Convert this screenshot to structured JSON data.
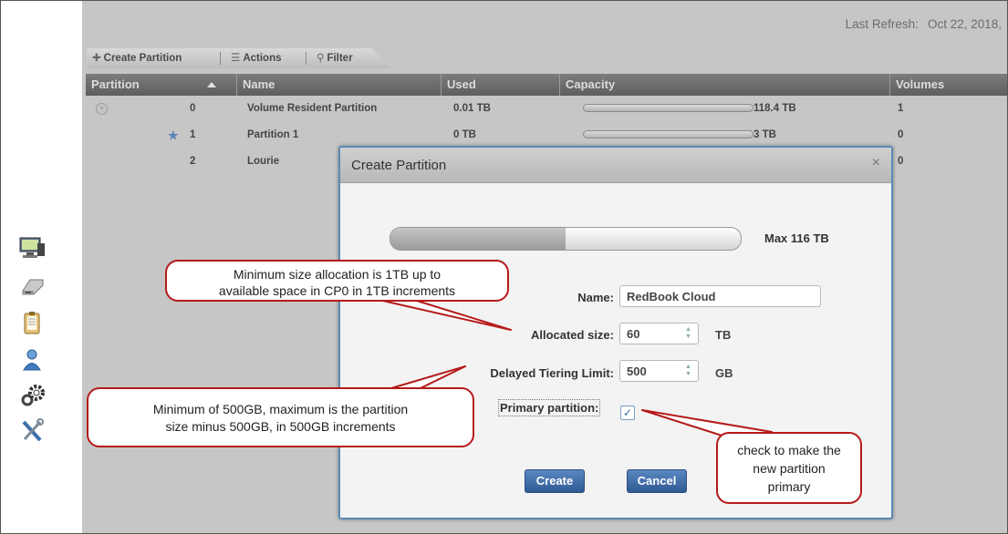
{
  "header": {
    "refresh_label": "Last Refresh:",
    "refresh_value": "Oct 22, 2018,"
  },
  "toolbar": {
    "create_label": "Create Partition",
    "actions_label": "Actions",
    "filter_label": "Filter"
  },
  "table": {
    "columns": [
      "Partition",
      "Name",
      "Used",
      "Capacity",
      "Volumes"
    ],
    "rows": [
      {
        "partition": "0",
        "name": "Volume Resident Partition",
        "used": "0.01 TB",
        "capacity": "118.4 TB",
        "volumes": "1",
        "capacity_used_fraction": 0.0
      },
      {
        "partition": "1",
        "name": "Partition 1",
        "used": "0 TB",
        "capacity": "3 TB",
        "volumes": "0",
        "capacity_used_fraction": 0.0
      },
      {
        "partition": "2",
        "name": "Lourie",
        "used": "",
        "capacity": "",
        "volumes": "0"
      }
    ]
  },
  "modal": {
    "title": "Create Partition",
    "close_glyph": "×",
    "allocation_fraction": 0.5,
    "max_label": "Max 116 TB",
    "name_label": "Name:",
    "name_value": "RedBook Cloud",
    "allocated_label": "Allocated size:",
    "allocated_value": "60",
    "allocated_unit": "TB",
    "tiering_label": "Delayed Tiering Limit:",
    "tiering_value": "500",
    "tiering_unit": "GB",
    "primary_label": "Primary partition:",
    "primary_checked": true,
    "create_button": "Create",
    "cancel_button": "Cancel"
  },
  "callouts": {
    "size": [
      "Minimum size allocation is 1TB up to",
      "available space in CP0 in 1TB increments"
    ],
    "tiering": [
      "Minimum of 500GB, maximum is the partition",
      "size minus 500GB, in 500GB increments"
    ],
    "primary": [
      "check to make the",
      "new partition",
      "primary"
    ]
  },
  "icons": [
    "monitor-icon",
    "storage-device-icon",
    "clipboard-icon",
    "user-icon",
    "gears-icon",
    "tools-icon"
  ]
}
